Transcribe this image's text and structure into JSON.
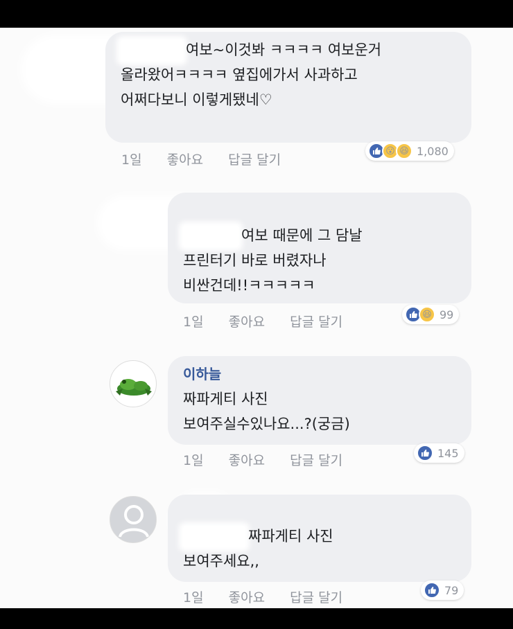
{
  "comments": [
    {
      "author": "",
      "lines": [
        "여보~이것봐 ㅋㅋㅋㅋ 여보운거",
        "올라왔어ㅋㅋㅋㅋ 옆집에가서 사과하고",
        "어쩌다보니 이렇게됐네♡"
      ],
      "time": "1일",
      "like_label": "좋아요",
      "reply_label": "답글 달기",
      "reactions": [
        "like-icon",
        "wow-icon",
        "haha-icon"
      ],
      "reaction_count": "1,080"
    },
    {
      "author": "",
      "lines": [
        "여보 때문에 그 담날",
        "프린터기 바로 버렸자나",
        "비싼건데!!ㅋㅋㅋㅋㅋ"
      ],
      "time": "1일",
      "like_label": "좋아요",
      "reply_label": "답글 달기",
      "reactions": [
        "like-icon",
        "haha-icon"
      ],
      "reaction_count": "99"
    },
    {
      "author": "이하늘",
      "lines": [
        "짜파게티 사진",
        "보여주실수있나요...?(궁금)"
      ],
      "time": "1일",
      "like_label": "좋아요",
      "reply_label": "답글 달기",
      "reactions": [
        "like-icon"
      ],
      "reaction_count": "145"
    },
    {
      "author": "",
      "lines": [
        "짜파게티 사진",
        "보여주세요,,"
      ],
      "time": "1일",
      "like_label": "좋아요",
      "reply_label": "답글 달기",
      "reactions": [
        "like-icon"
      ],
      "reaction_count": "79"
    }
  ],
  "colors": {
    "bubble": "#eeeff2",
    "name_link": "#365899",
    "meta_text": "#90949c",
    "like_blue": "#4267b2",
    "emoji_yellow": "#f7c547"
  }
}
